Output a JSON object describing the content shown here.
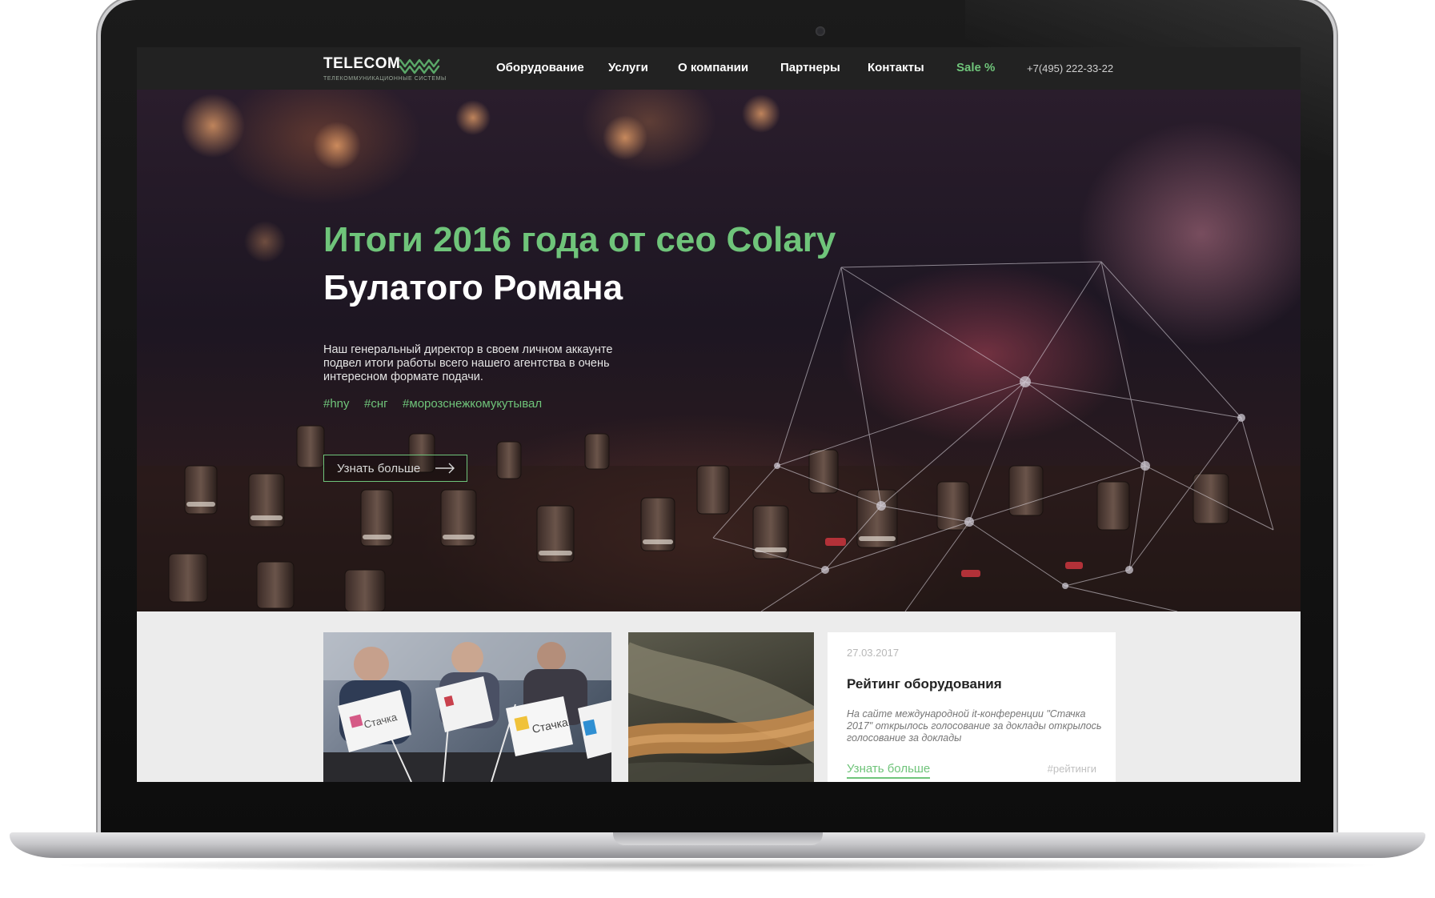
{
  "brand": {
    "name": "TELECOM",
    "tagline": "телекоммуникационные системы"
  },
  "nav": {
    "items": [
      "Оборудование",
      "Услуги",
      "О компании",
      "Партнеры",
      "Контакты"
    ],
    "sale": "Sale %",
    "phone": "+7(495) 222-33-22"
  },
  "hero": {
    "title_green": "Итоги 2016 года от сео Colary",
    "title_white": "Булатого Романа",
    "description": "Наш генеральный директор в своем личном аккаунте подвел итоги работы всего нашего агентства в очень интересном формате подачи.",
    "tags": [
      "#hny",
      "#снг",
      "#морозснежкомукутывал"
    ],
    "button_label": "Узнать больше"
  },
  "news": {
    "photo_flag_text": "Стачка",
    "card": {
      "date": "27.03.2017",
      "title": "Рейтинг оборудования",
      "excerpt": "На сайте международной it-конференции \"Стачка 2017\" открылось голосование за доклады открылось голосование за доклады",
      "more_label": "Узнать больше",
      "tag": "#рейтинги"
    }
  },
  "colors": {
    "accent_green": "#6fc47a",
    "navbar_bg": "#222222",
    "page_bg": "#ececec"
  }
}
